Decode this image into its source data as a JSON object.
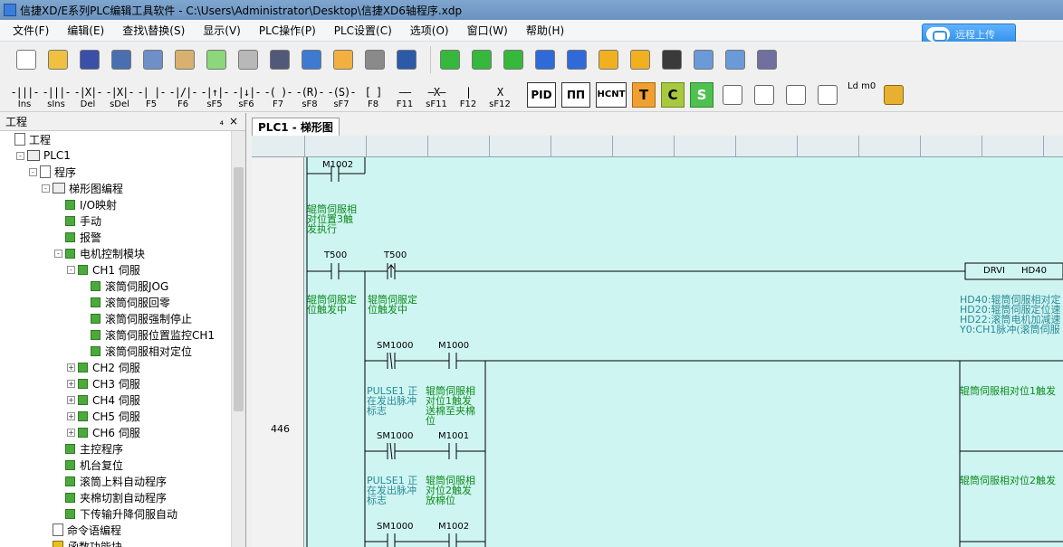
{
  "window": {
    "title": "信捷XD/E系列PLC编辑工具软件 - C:\\Users\\Administrator\\Desktop\\信捷XD6轴程序.xdp"
  },
  "menu": [
    "文件(F)",
    "编辑(E)",
    "查找\\替换(S)",
    "显示(V)",
    "PLC操作(P)",
    "PLC设置(C)",
    "选项(O)",
    "窗口(W)",
    "帮助(H)"
  ],
  "connect_button": {
    "label": "远程上传"
  },
  "toolbar1_icons": [
    "new-icon",
    "open-icon",
    "save-icon",
    "cut-icon",
    "copy-icon",
    "paste-icon",
    "undo-icon",
    "redo-icon",
    "find-icon",
    "monitor-icon",
    "document-icon",
    "print-icon",
    "help-icon",
    "download-icon",
    "upload-icon",
    "online-icon",
    "run-icon",
    "stop-icon",
    "lock-icon",
    "unlock-icon",
    "device-icon",
    "zoom-find-icon",
    "zoom-page-icon",
    "comm-icon"
  ],
  "ladder_tools": [
    {
      "sym": "-|||-",
      "label": "Ins"
    },
    {
      "sym": "-|||-",
      "label": "sIns"
    },
    {
      "sym": "-|X|-",
      "label": "Del"
    },
    {
      "sym": "-|X|-",
      "label": "sDel"
    },
    {
      "sym": "-| |-",
      "label": "F5"
    },
    {
      "sym": "-|/|-",
      "label": "F6"
    },
    {
      "sym": "-|↑|-",
      "label": "sF5"
    },
    {
      "sym": "-|↓|-",
      "label": "sF6"
    },
    {
      "sym": "-( )-",
      "label": "F7"
    },
    {
      "sym": "-(R)-",
      "label": "sF8"
    },
    {
      "sym": "-(S)-",
      "label": "sF7"
    },
    {
      "sym": "[  ]",
      "label": "F8"
    },
    {
      "sym": "——",
      "label": "F11"
    },
    {
      "sym": "—X—",
      "label": "sF11"
    },
    {
      "sym": "|",
      "label": "F12"
    },
    {
      "sym": "X",
      "label": "sF12"
    }
  ],
  "ladder_extra": {
    "pid": "PID",
    "pulse": "ПП",
    "hcnt": "HCNT",
    "t": "T",
    "c": "C",
    "s": "S",
    "ldm": "Ld m0"
  },
  "panel": {
    "title": "工程",
    "pin": "₄",
    "close": "×"
  },
  "tree": [
    {
      "label": "工程",
      "level": 0,
      "icon": "doc",
      "exp": ""
    },
    {
      "label": "PLC1",
      "level": 1,
      "icon": "pc",
      "exp": "-"
    },
    {
      "label": "程序",
      "level": 2,
      "icon": "doc",
      "exp": "-"
    },
    {
      "label": "梯形图编程",
      "level": 3,
      "icon": "ladder",
      "exp": "-"
    },
    {
      "label": "I/O映射",
      "level": 4,
      "icon": "green",
      "exp": ""
    },
    {
      "label": "手动",
      "level": 4,
      "icon": "green",
      "exp": ""
    },
    {
      "label": "报警",
      "level": 4,
      "icon": "green",
      "exp": ""
    },
    {
      "label": "电机控制模块",
      "level": 4,
      "icon": "green",
      "exp": "-"
    },
    {
      "label": "CH1 伺服",
      "level": 5,
      "icon": "green",
      "exp": "-"
    },
    {
      "label": "滚筒伺服JOG",
      "level": 6,
      "icon": "green",
      "exp": ""
    },
    {
      "label": "滚筒伺服回零",
      "level": 6,
      "icon": "green",
      "exp": ""
    },
    {
      "label": "滚筒伺服强制停止",
      "level": 6,
      "icon": "green",
      "exp": ""
    },
    {
      "label": "滚筒伺服位置监控CH1",
      "level": 6,
      "icon": "green",
      "exp": ""
    },
    {
      "label": "滚筒伺服相对定位",
      "level": 6,
      "icon": "green",
      "exp": ""
    },
    {
      "label": "CH2 伺服",
      "level": 5,
      "icon": "green",
      "exp": "+"
    },
    {
      "label": "CH3 伺服",
      "level": 5,
      "icon": "green",
      "exp": "+"
    },
    {
      "label": "CH4 伺服",
      "level": 5,
      "icon": "green",
      "exp": "+"
    },
    {
      "label": "CH5 伺服",
      "level": 5,
      "icon": "green",
      "exp": "+"
    },
    {
      "label": "CH6 伺服",
      "level": 5,
      "icon": "green",
      "exp": "+"
    },
    {
      "label": "主控程序",
      "level": 4,
      "icon": "green",
      "exp": ""
    },
    {
      "label": "机台复位",
      "level": 4,
      "icon": "green",
      "exp": ""
    },
    {
      "label": "滚筒上料自动程序",
      "level": 4,
      "icon": "green",
      "exp": ""
    },
    {
      "label": "夹棉切割自动程序",
      "level": 4,
      "icon": "green",
      "exp": ""
    },
    {
      "label": "下传输升降伺服自动",
      "level": 4,
      "icon": "green",
      "exp": ""
    },
    {
      "label": "命令语编程",
      "level": 3,
      "icon": "cmd",
      "exp": ""
    },
    {
      "label": "函数功能块",
      "level": 3,
      "icon": "yellow",
      "exp": ""
    }
  ],
  "editor": {
    "tab": "PLC1 - 梯形图",
    "rung_number": "446",
    "labels": {
      "m1002_top": "M1002",
      "c_top": "辊筒伺服相\n对位置3触\n发执行",
      "t500a": "T500",
      "t500b": "T500",
      "c_t500a": "辊筒伺服定\n位触发中",
      "c_t500b": "辊筒伺服定\n位触发中",
      "drvi": "DRVI",
      "hd40": "HD40",
      "c_right": "HD40:辊筒伺服相对定\nHD20:辊筒伺服定位速\nHD22:滚筒电机加减速\nY0:CH1脉冲(滚筒伺服",
      "sm1000a": "SM1000",
      "m1000": "M1000",
      "pulse_a": "PULSE1 正\n在发出脉冲\n标志",
      "c_m1000": "辊筒伺服相\n对位1触发\n送棉至夹棉\n位",
      "c_r1": "辊筒伺服相对位1触发",
      "sm1000b": "SM1000",
      "m1001": "M1001",
      "pulse_b": "PULSE1 正\n在发出脉冲\n标志",
      "c_m1001": "辊筒伺服相\n对位2触发\n放棉位",
      "c_r2": "辊筒伺服相对位2触发",
      "sm1000c": "SM1000",
      "m1002": "M1002"
    }
  }
}
